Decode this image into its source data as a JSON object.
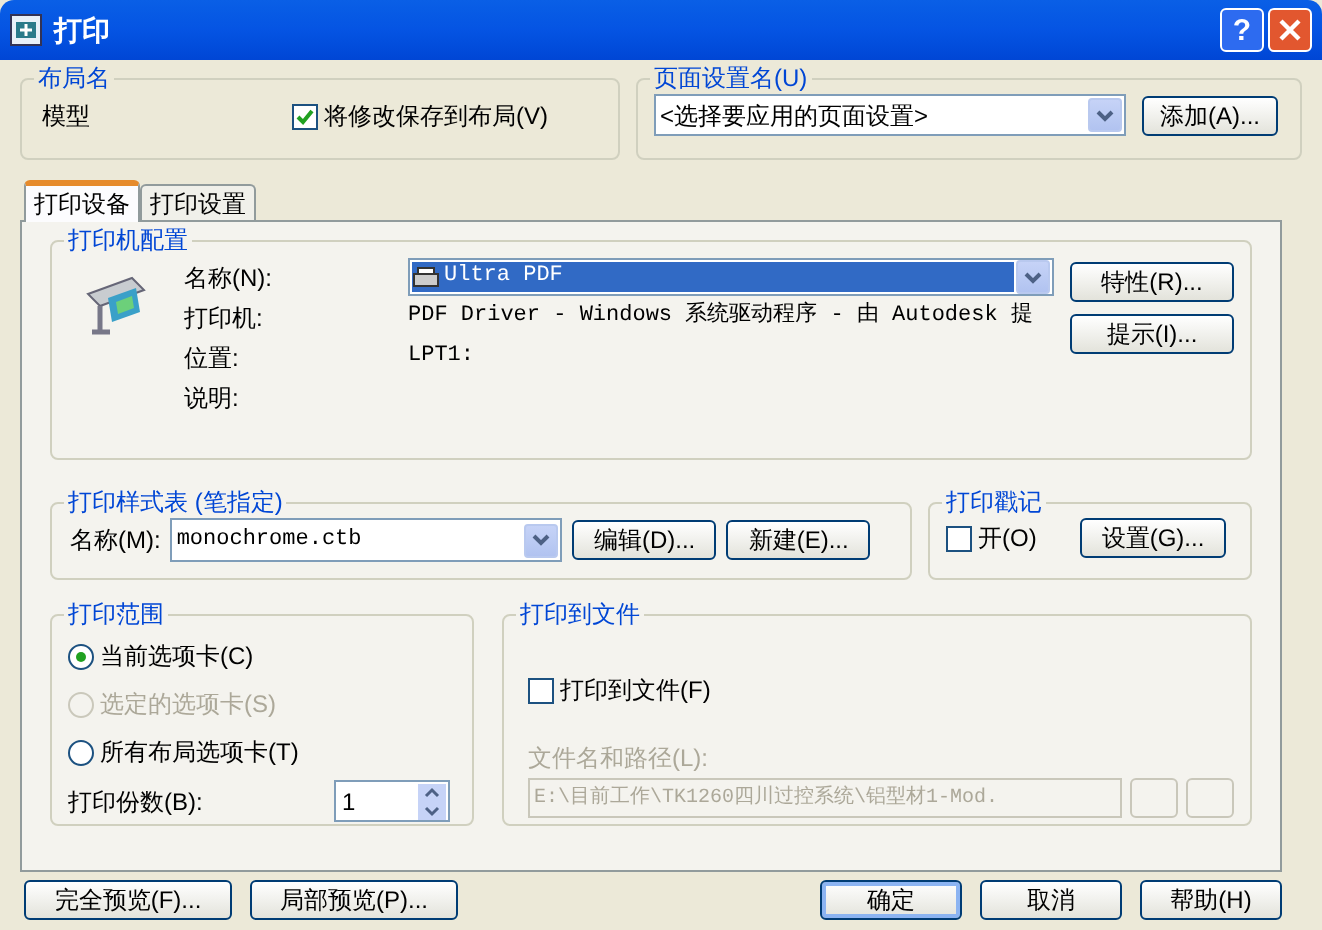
{
  "window": {
    "title": "打印",
    "help_button": "?"
  },
  "layout_name": {
    "title": "布局名",
    "value": "模型",
    "save_checkbox": {
      "label": "将修改保存到布局(V)",
      "checked": true
    }
  },
  "page_setup": {
    "title": "页面设置名(U)",
    "select_value": "<选择要应用的页面设置>",
    "add_button": "添加(A)..."
  },
  "tabs": [
    {
      "label": "打印设备",
      "selected": true
    },
    {
      "label": "打印设置",
      "selected": false
    }
  ],
  "printer": {
    "title": "打印机配置",
    "fields": [
      {
        "label": "名称(N):",
        "kind": "select",
        "value": "Ultra PDF",
        "focused": true
      },
      {
        "label": "打印机:",
        "kind": "text",
        "value": "PDF Driver - Windows 系统驱动程序 - 由 Autodesk 提"
      },
      {
        "label": "位置:",
        "kind": "text",
        "value": "LPT1:"
      },
      {
        "label": "说明:",
        "kind": "text"
      }
    ],
    "buttons": [
      "特性(R)...",
      "提示(I)..."
    ]
  },
  "plot_style": {
    "title": "打印样式表 (笔指定)",
    "label": "名称(M):",
    "value": "monochrome.ctb",
    "buttons": [
      "编辑(D)...",
      "新建(E)..."
    ]
  },
  "stamp": {
    "title": "打印戳记",
    "checkbox": {
      "label": "开(O)",
      "checked": false
    },
    "button": "设置(G)..."
  },
  "range": {
    "title": "打印范围",
    "options": [
      {
        "label": "当前选项卡(C)",
        "selected": true,
        "disabled": false
      },
      {
        "label": "选定的选项卡(S)",
        "selected": false,
        "disabled": true
      },
      {
        "label": "所有布局选项卡(T)",
        "selected": false,
        "disabled": false
      }
    ],
    "copies_label": "打印份数(B):",
    "copies_value": "1"
  },
  "print_to_file": {
    "title": "打印到文件",
    "checkbox": {
      "label": "打印到文件(F)",
      "checked": false
    },
    "path_label": "文件名和路径(L):",
    "path_value": "E:\\目前工作\\TK1260四川过控系统\\铝型材1-Mod.",
    "disabled": true
  },
  "preview_buttons": [
    {
      "label": "完全预览(F)..."
    },
    {
      "label": "局部预览(P)..."
    }
  ],
  "dialog_buttons": [
    {
      "label": "确定",
      "default": true
    },
    {
      "label": "取消",
      "default": false
    },
    {
      "label": "帮助(H)",
      "default": false
    }
  ]
}
